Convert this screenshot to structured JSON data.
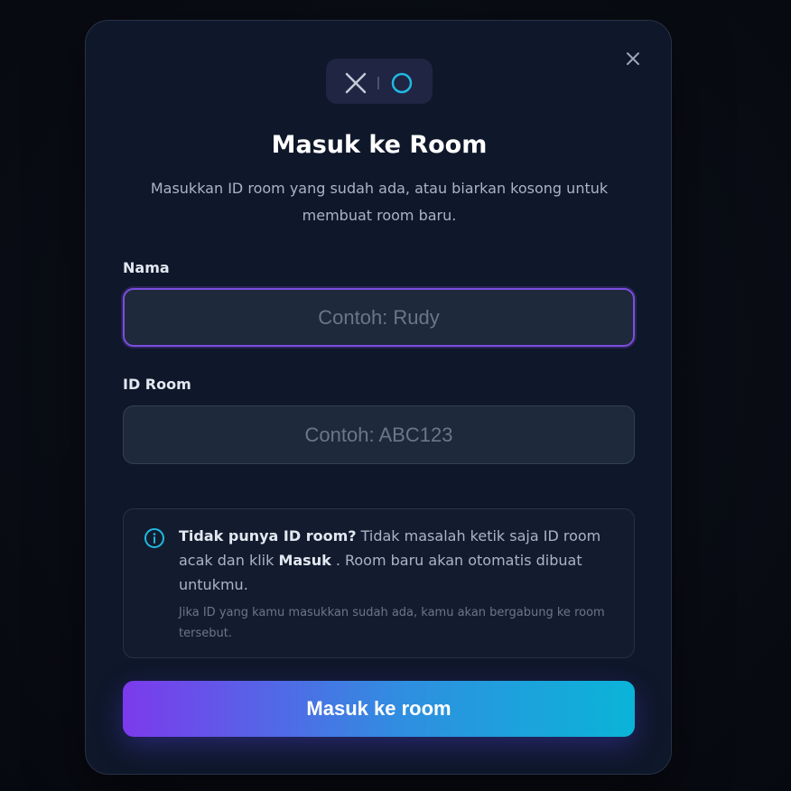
{
  "modal": {
    "title": "Masuk ke Room",
    "subtitle": "Masukkan ID room yang sudah ada, atau biarkan kosong untuk membuat room baru."
  },
  "logo": {
    "x_symbol": "X",
    "separator": "|",
    "o_symbol": "O"
  },
  "icons": {
    "close": "close-icon",
    "info": "info-icon"
  },
  "form": {
    "name": {
      "label": "Nama",
      "value": "",
      "placeholder": "Contoh: Rudy"
    },
    "room_id": {
      "label": "ID Room",
      "value": "",
      "placeholder": "Contoh: ABC123"
    }
  },
  "info": {
    "bold_lead": "Tidak punya ID room?",
    "text_1": " Tidak masalah ketik saja ID room acak dan klik ",
    "bold_action": "Masuk",
    "text_2": " . Room baru akan otomatis dibuat untukmu.",
    "note": "Jika ID yang kamu masukkan sudah ada, kamu akan bergabung ke room tersebut."
  },
  "submit": {
    "label": "Masuk ke room"
  },
  "colors": {
    "background": "#090c14",
    "modal": "#0f172a",
    "input": "#1e293b",
    "focus_ring": "#7c4dde",
    "gradient_start": "#7c3aed",
    "gradient_end": "#0ab4d8",
    "accent_cyan": "#22b8e0"
  }
}
